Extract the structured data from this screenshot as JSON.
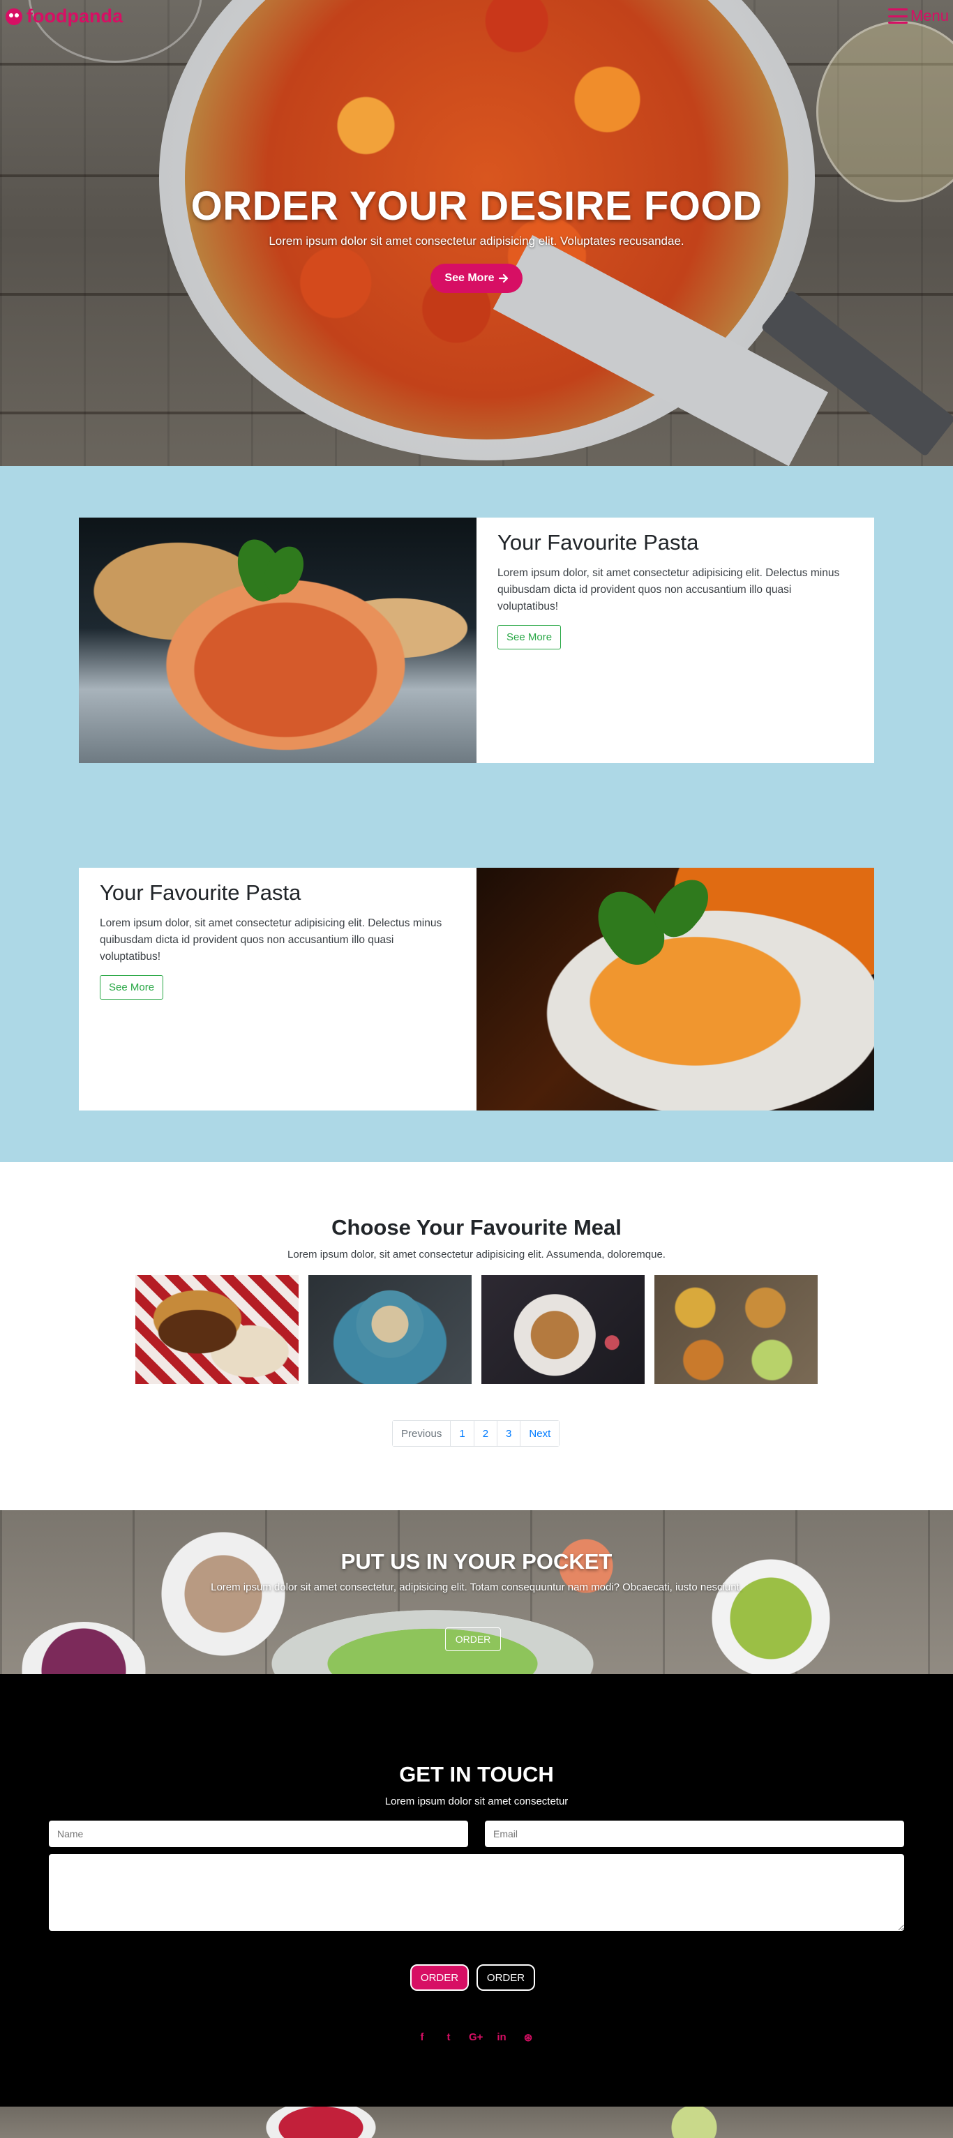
{
  "nav": {
    "brand": "foodpanda",
    "menu_label": "Menu"
  },
  "hero": {
    "title": "ORDER YOUR DESIRE FOOD",
    "subtitle": "Lorem ipsum dolor sit amet consectetur adipisicing elit. Voluptates recusandae.",
    "button_label": "See More",
    "button_icon": "arrow-right-icon"
  },
  "features": [
    {
      "title": "Your Favourite Pasta",
      "body": "Lorem ipsum dolor, sit amet consectetur adipisicing elit. Delectus minus quibusdam dicta id provident quos non accusantium illo quasi voluptatibus!",
      "button_label": "See More"
    },
    {
      "title": "Your Favourite Pasta",
      "body": "Lorem ipsum dolor, sit amet consectetur adipisicing elit. Delectus minus quibusdam dicta id provident quos non accusantium illo quasi voluptatibus!",
      "button_label": "See More"
    }
  ],
  "meals": {
    "title": "Choose Your Favourite Meal",
    "subtitle": "Lorem ipsum dolor, sit amet consectetur adipisicing elit. Assumenda, doloremque.",
    "pagination": [
      "Previous",
      "1",
      "2",
      "3",
      "Next"
    ]
  },
  "pocket": {
    "title": "PUT US IN YOUR POCKET",
    "subtitle": "Lorem ipsum dolor sit amet consectetur, adipisicing elit. Totam consequuntur nam modi? Obcaecati, iusto nesciunt.",
    "button_label": "ORDER"
  },
  "contact": {
    "title": "GET IN TOUCH",
    "subtitle": "Lorem ipsum dolor sit amet consectetur",
    "name_placeholder": "Name",
    "email_placeholder": "Email",
    "order_primary": "ORDER",
    "order_secondary": "ORDER",
    "socials": [
      "f",
      "t",
      "G+",
      "in",
      "⊛"
    ]
  },
  "colors": {
    "brand": "#d70f64",
    "section_blue": "#add8e6",
    "outline_green": "#28a745",
    "link_blue": "#007bff"
  }
}
